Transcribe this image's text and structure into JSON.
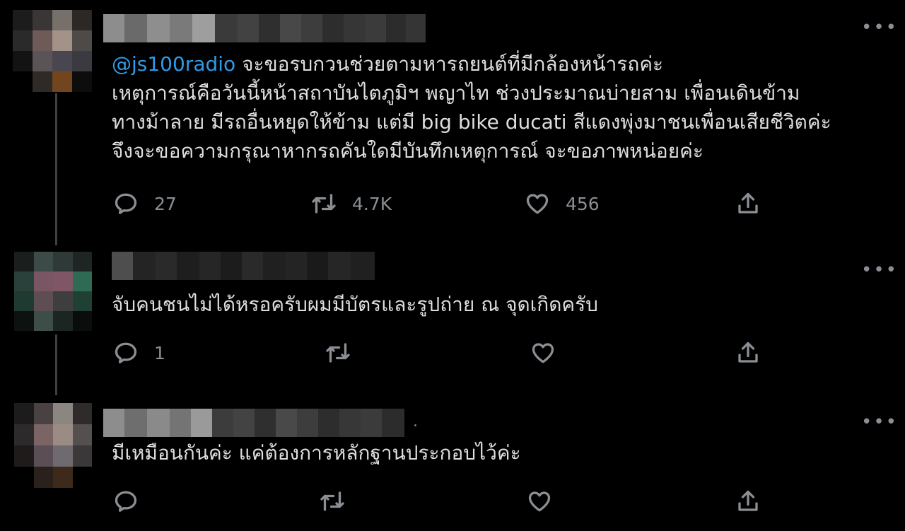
{
  "tweets": [
    {
      "mention": "@js100radio",
      "text": " จะขอรบกวนช่วยตามหารถยนต์ที่มีกล้องหน้ารถค่ะ\nเหตุการณ์คือวันนี้หน้าสถาบันไตภูมิฯ พญาไท ช่วงประมาณบ่ายสาม เพื่อนเดินข้าม\nทางม้าลาย มีรถอื่นหยุดให้ข้าม แต่มี big bike ducati สีแดงพุ่งมาชนเพื่อนเสียชีวิตค่ะ\nจึงจะขอความกรุณาหากรถคันใดมีบันทึกเหตุการณ์ จะขอภาพหน่อยค่ะ",
      "replies": "27",
      "retweets": "4.7K",
      "likes": "456"
    },
    {
      "mention": "",
      "text": "จับคนชนไม่ได้หรอครับผมมีบัตรและรูปถ่าย ณ จุดเกิดครับ",
      "replies": "1",
      "retweets": "",
      "likes": ""
    },
    {
      "mention": "",
      "text": "มีเหมือนกันค่ะ แค่ต้องการหลักฐานประกอบไว้ค่ะ",
      "replies": "",
      "retweets": "",
      "likes": "",
      "name_suffix": "."
    }
  ],
  "more_glyph": "•••",
  "icons": [
    "reply-icon",
    "retweet-icon",
    "like-icon",
    "share-icon",
    "more-icon"
  ],
  "colors": {
    "background": "#000000",
    "accent": "#2f9be8",
    "secondary": "#8b8f94",
    "text": "#dedede"
  }
}
